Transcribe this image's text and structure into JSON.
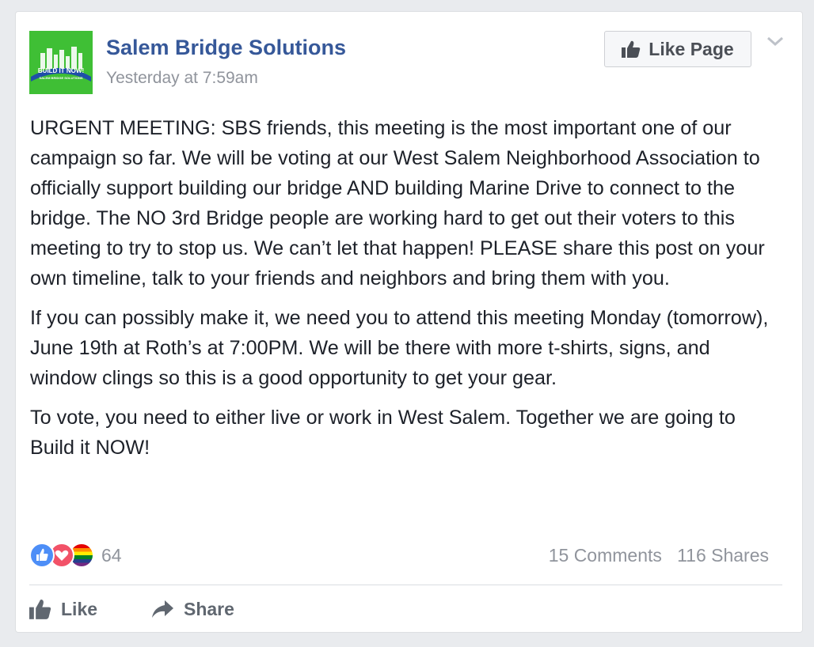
{
  "post": {
    "page_name": "Salem Bridge Solutions",
    "timestamp": "Yesterday at 7:59am",
    "avatar": {
      "line1": "BUILD IT NOW!",
      "line2": "SALEM BRIDGE SOLUTIONS"
    },
    "like_page_label": "Like Page",
    "paragraphs": [
      "URGENT MEETING: SBS friends, this meeting is the most important one of our campaign so far. We will be voting at our West Salem Neighborhood Association to officially support building our bridge AND building Marine Drive to connect to the bridge. The NO 3rd Bridge people are working hard to get out their voters to this meeting to try to stop us. We can’t let that happen! PLEASE share this post on your own timeline, talk to your friends and neighbors and bring them with you.",
      "If you can possibly make it, we need you to attend this meeting Monday (tomorrow), June 19th at Roth’s at 7:00PM. We will be there with more t-shirts, signs, and window clings so this is a good opportunity to get your gear.",
      "To vote, you need to either live or work in West Salem. Together we are going to Build it NOW!"
    ],
    "reactions": {
      "icons": [
        "like-icon",
        "love-icon",
        "pride-icon"
      ],
      "count": "64"
    },
    "comments": "15 Comments",
    "shares": "116 Shares",
    "actions": {
      "like": "Like",
      "share": "Share"
    }
  },
  "colors": {
    "brand": "#365899",
    "muted": "#90949c",
    "text": "#1d2129",
    "avatar_bg": "#3fbf35"
  }
}
